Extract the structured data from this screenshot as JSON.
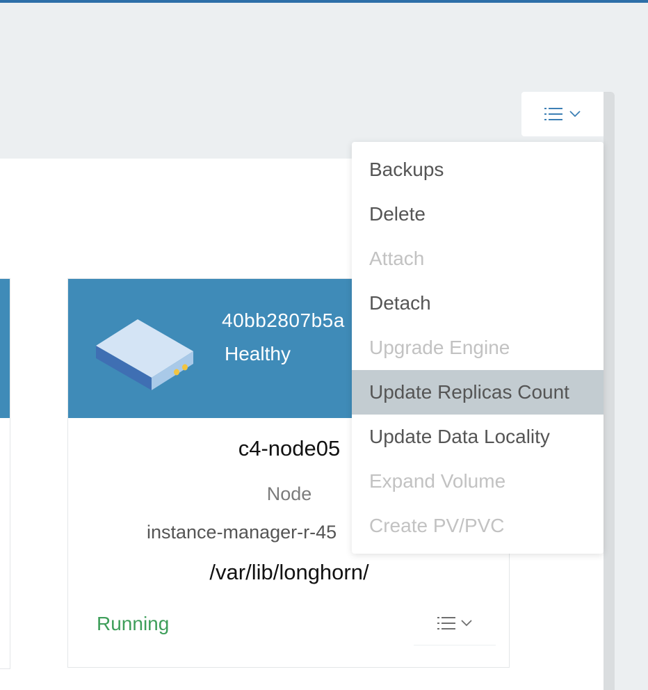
{
  "header": {
    "action_icon": "list-icon",
    "chevron_icon": "chevron-down-icon"
  },
  "dropdown": {
    "items": [
      {
        "label": "Backups",
        "disabled": false,
        "highlighted": false
      },
      {
        "label": "Delete",
        "disabled": false,
        "highlighted": false
      },
      {
        "label": "Attach",
        "disabled": true,
        "highlighted": false
      },
      {
        "label": "Detach",
        "disabled": false,
        "highlighted": false
      },
      {
        "label": "Upgrade Engine",
        "disabled": true,
        "highlighted": false
      },
      {
        "label": "Update Replicas Count",
        "disabled": false,
        "highlighted": true
      },
      {
        "label": "Update Data Locality",
        "disabled": false,
        "highlighted": false
      },
      {
        "label": "Expand Volume",
        "disabled": true,
        "highlighted": false
      },
      {
        "label": "Create PV/PVC",
        "disabled": true,
        "highlighted": false
      }
    ]
  },
  "replica": {
    "name": "40bb2807b5a",
    "health": "Healthy",
    "node": "c4-node05",
    "node_label": "Node",
    "instance_manager": "instance-manager-r-45",
    "data_path": "/var/lib/longhorn/",
    "status": "Running",
    "icon": "disk-icon"
  },
  "colors": {
    "accent": "#3f8bb8",
    "running": "#3e9e5a",
    "disabled_text": "#c2c2c2",
    "highlight": "#c3ccd1"
  }
}
